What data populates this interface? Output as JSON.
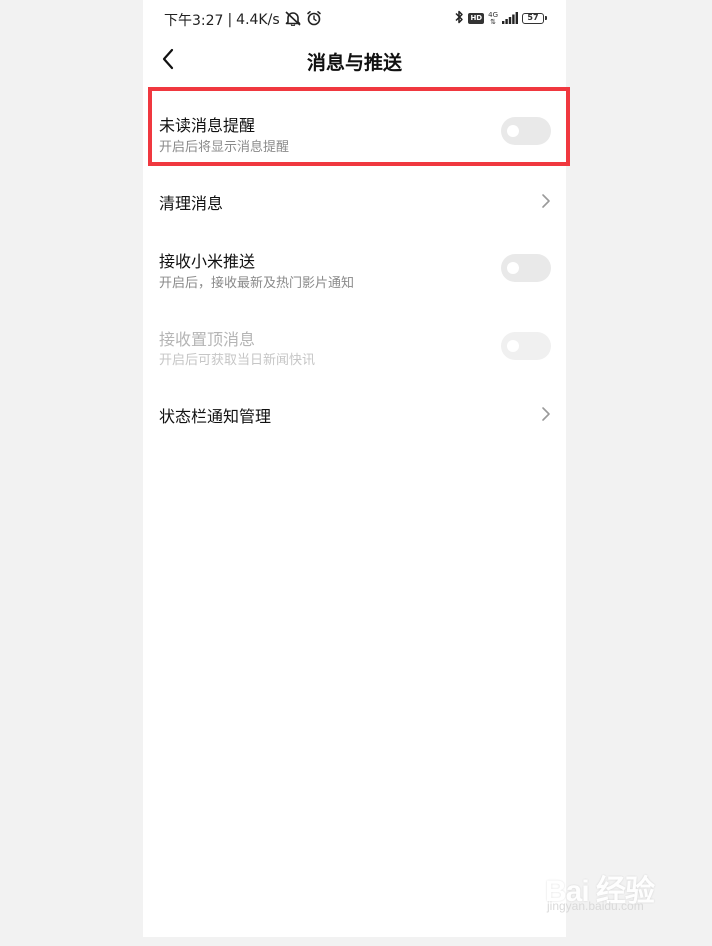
{
  "status_bar": {
    "time": "下午3:27",
    "separator": "|",
    "net_speed": "4.4K/s",
    "hd_badge": "HD",
    "network_type": "4G",
    "battery_level": "57",
    "icons": [
      "alarm-off-icon",
      "alarm-clock-icon",
      "bluetooth-icon",
      "signal-icon",
      "battery-icon"
    ]
  },
  "header": {
    "title": "消息与推送",
    "back_icon": "chevron-left-icon"
  },
  "settings": [
    {
      "title": "未读消息提醒",
      "subtitle": "开启后将显示消息提醒",
      "control": "toggle",
      "enabled": false,
      "disabled": false
    },
    {
      "title": "清理消息",
      "control": "chevron"
    },
    {
      "title": "接收小米推送",
      "subtitle": "开启后，接收最新及热门影片通知",
      "control": "toggle",
      "enabled": false,
      "disabled": false
    },
    {
      "title": "接收置顶消息",
      "subtitle": "开启后可获取当日新闻快讯",
      "control": "toggle",
      "enabled": false,
      "disabled": true
    },
    {
      "title": "状态栏通知管理",
      "control": "chevron"
    }
  ],
  "highlight_color": "#f0383f",
  "watermark": {
    "logo_text": "Bai 经验",
    "url": "jingyan.baidu.com"
  }
}
